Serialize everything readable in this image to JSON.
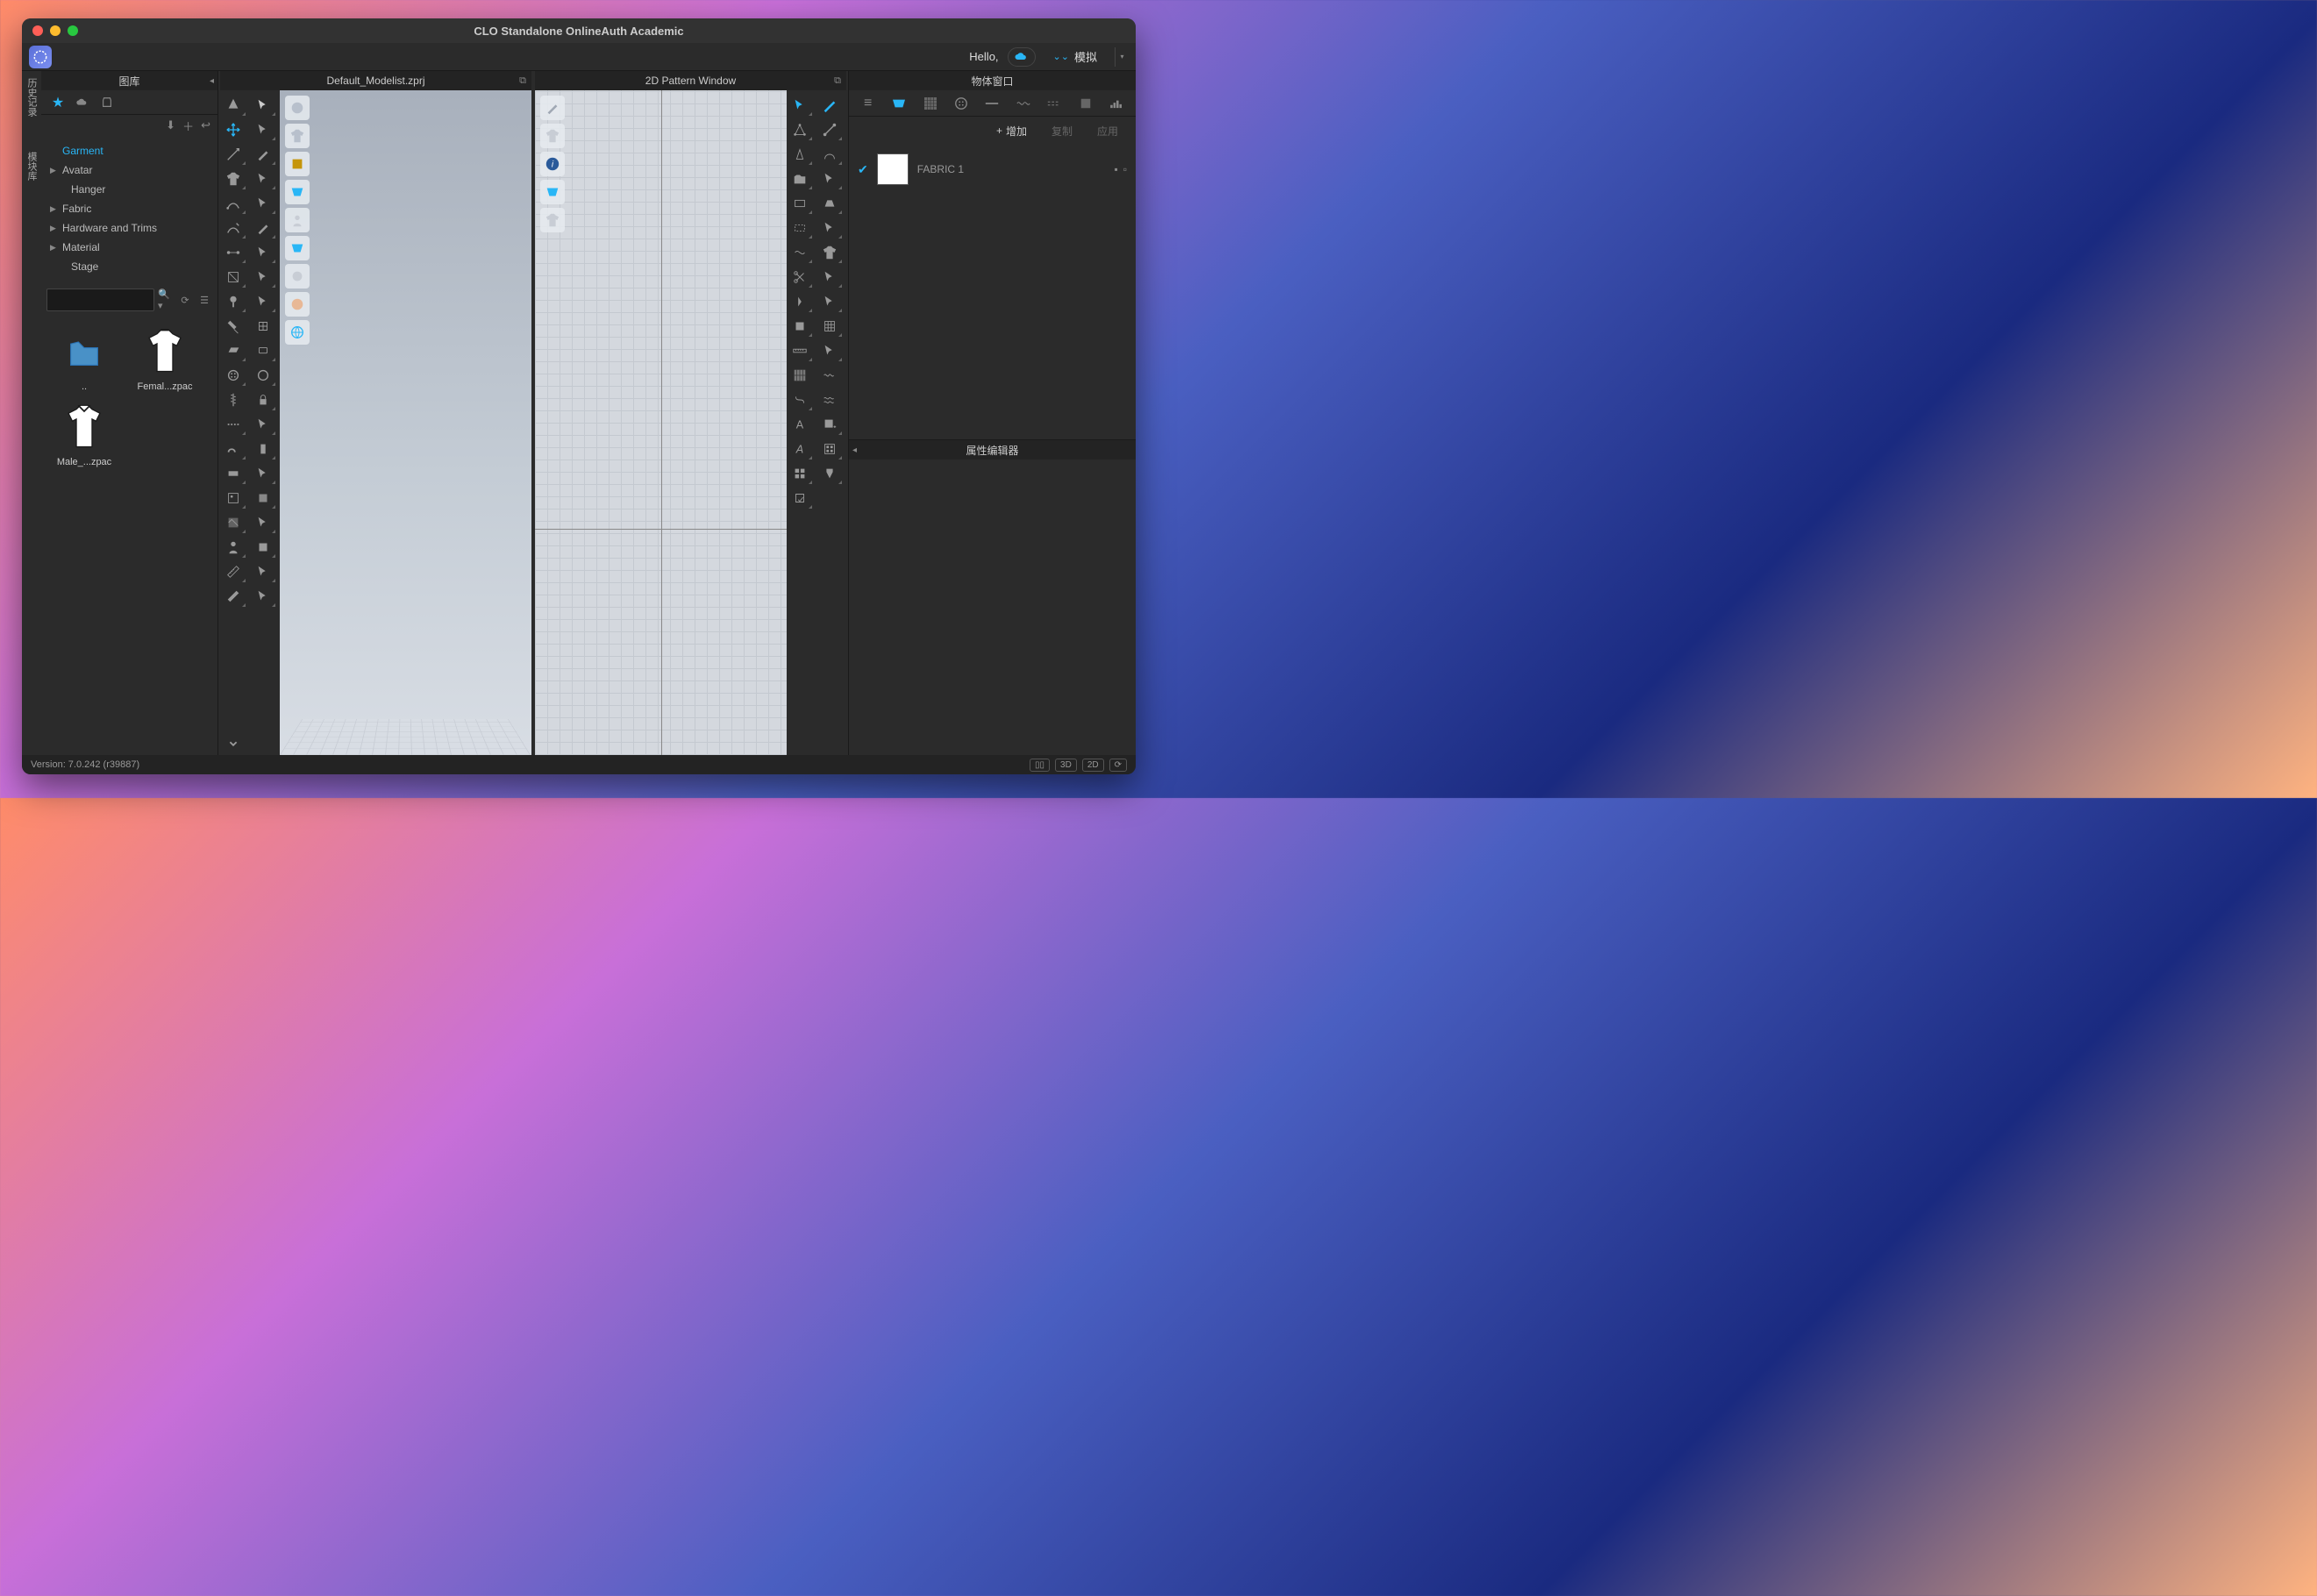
{
  "window": {
    "title": "CLO Standalone OnlineAuth Academic"
  },
  "menubar": {
    "hello": "Hello,",
    "simulate": "模拟"
  },
  "side_tabs": {
    "history": "历史记录",
    "module": "模块库"
  },
  "library": {
    "title": "图库",
    "tree": {
      "garment": "Garment",
      "avatar": "Avatar",
      "hanger": "Hanger",
      "fabric": "Fabric",
      "hardware": "Hardware and Trims",
      "material": "Material",
      "stage": "Stage"
    },
    "thumbs": {
      "up": "..",
      "female": "Femal...zpac",
      "male": "Male_...zpac"
    }
  },
  "views": {
    "threeD": "Default_Modelist.zprj",
    "twoD": "2D Pattern Window"
  },
  "object_browser": {
    "title": "物体窗口",
    "add": "增加",
    "copy": "复制",
    "apply": "应用",
    "fabric1": "FABRIC 1"
  },
  "property_editor": {
    "title": "属性编辑器"
  },
  "status": {
    "version": "Version: 7.0.242 (r39887)",
    "b3d": "3D",
    "b2d": "2D"
  }
}
